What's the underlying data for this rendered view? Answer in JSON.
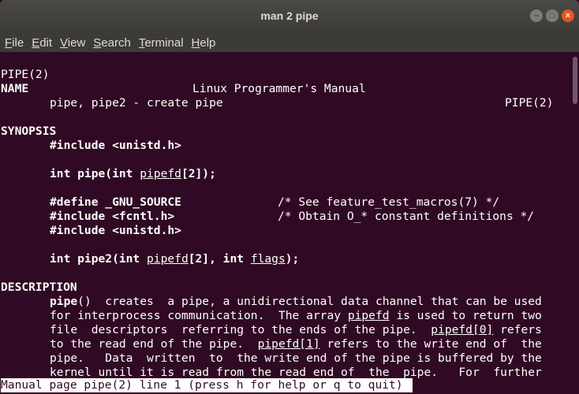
{
  "window": {
    "title": "man 2 pipe"
  },
  "menu": [
    "File",
    "Edit",
    "View",
    "Search",
    "Terminal",
    "Help"
  ],
  "header": {
    "left": "PIPE(2)",
    "center": "Linux Programmer's Manual",
    "right": "PIPE(2)"
  },
  "lines": {
    "name_head": "NAME",
    "name_text": "pipe, pipe2 - create pipe",
    "synopsis_head": "SYNOPSIS",
    "include_unistd": "#include <unistd.h>",
    "pipe_proto_a": "int pipe(int ",
    "pipe_proto_arg": "pipefd",
    "pipe_proto_b": "[2]);",
    "define_gnu": "#define _GNU_SOURCE",
    "define_gnu_comment": "/* See feature_test_macros(7) */",
    "include_fcntl": "#include <fcntl.h>",
    "include_fcntl_comment": "/* Obtain O_* constant definitions */",
    "include_unistd2": "#include <unistd.h>",
    "pipe2_a": "int pipe2(int ",
    "pipe2_arg1": "pipefd",
    "pipe2_b": "[2], int ",
    "pipe2_arg2": "flags",
    "pipe2_c": ");",
    "description_head": "DESCRIPTION",
    "d1_bold": "pipe",
    "d1": "()  creates  a pipe, a unidirectional data channel that can be used",
    "d2a": "for interprocess communication.  The array ",
    "d2u": "pipefd",
    "d2b": " is used to return two",
    "d3a": "file  descriptors  referring to the ends of the pipe.  ",
    "d3u": "pipefd[0]",
    "d3b": " refers",
    "d4a": "to the read end of the pipe.  ",
    "d4u": "pipefd[1]",
    "d4b": " refers to the write end of  the",
    "d5": "pipe.   Data  written  to  the write end of the pipe is buffered by the",
    "d6": "kernel until it is read from the read end of  the  pipe.   For  further"
  },
  "status": "Manual page pipe(2) line 1 (press h for help or q to quit)",
  "colors": {
    "terminal_bg": "#300a24",
    "titlebar_bg": "#3c3b37",
    "close_button": "#e95420"
  }
}
